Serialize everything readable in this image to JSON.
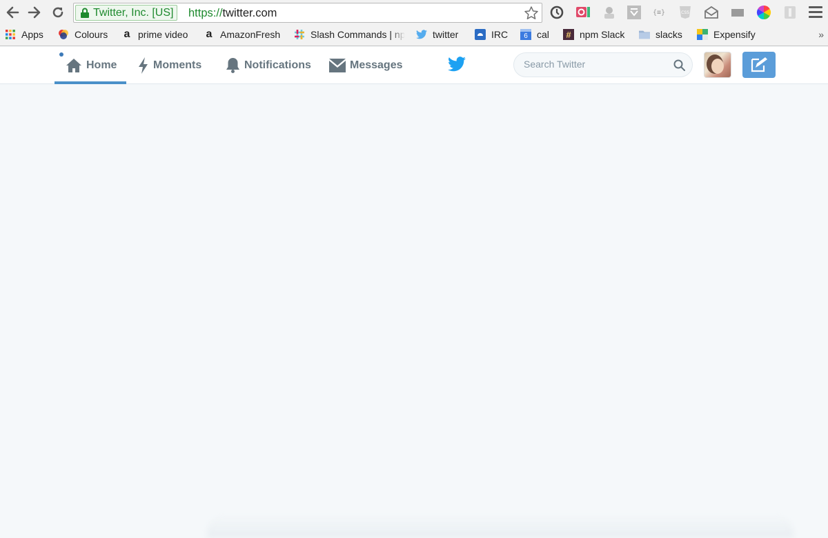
{
  "browser": {
    "back_icon": "arrow-left-icon",
    "forward_icon": "arrow-right-icon",
    "reload_icon": "reload-icon",
    "secure_label": "Twitter, Inc. [US]",
    "url_scheme": "https://",
    "url_host": "twitter.com",
    "bookmark_star_icon": "star-icon",
    "extensions": [
      {
        "icon": "history-clock-icon"
      },
      {
        "icon": "quip-icon"
      },
      {
        "icon": "badge-icon"
      },
      {
        "icon": "pocket-icon"
      },
      {
        "icon": "json-icon",
        "text": "{≡}"
      },
      {
        "icon": "css-icon",
        "text": "CSS"
      },
      {
        "icon": "mail-icon"
      },
      {
        "icon": "window-icon"
      },
      {
        "icon": "color-wheel-icon"
      },
      {
        "icon": "puzzle-icon"
      }
    ],
    "menu_icon": "hamburger-menu-icon"
  },
  "bookmarks": {
    "items": [
      {
        "label": "Apps",
        "icon": "apps-grid-icon"
      },
      {
        "label": "Colours",
        "icon": "colours-icon"
      },
      {
        "label": "prime video",
        "icon": "amazon-icon"
      },
      {
        "label": "AmazonFresh",
        "icon": "amazon-icon"
      },
      {
        "label": "Slash Commands | np",
        "icon": "slack-icon"
      },
      {
        "label": "twitter",
        "icon": "twitter-bird-icon"
      },
      {
        "label": "IRC",
        "icon": "irc-icon"
      },
      {
        "label": "cal",
        "icon": "calendar-icon",
        "badge": "6"
      },
      {
        "label": "npm Slack",
        "icon": "hash-icon"
      },
      {
        "label": "slacks",
        "icon": "folder-icon"
      },
      {
        "label": "Expensify",
        "icon": "expensify-icon"
      }
    ],
    "more": "»"
  },
  "twitter": {
    "tabs": [
      {
        "label": "Home",
        "icon": "home-icon",
        "active": true
      },
      {
        "label": "Moments",
        "icon": "lightning-icon"
      },
      {
        "label": "Notifications",
        "icon": "bell-icon"
      },
      {
        "label": "Messages",
        "icon": "envelope-icon"
      }
    ],
    "search_placeholder": "Search Twitter",
    "colors": {
      "brand": "#1da1f2",
      "accent": "#4a90c9",
      "tweet_button": "#5b9dd9",
      "background": "#f5f8fa"
    }
  }
}
